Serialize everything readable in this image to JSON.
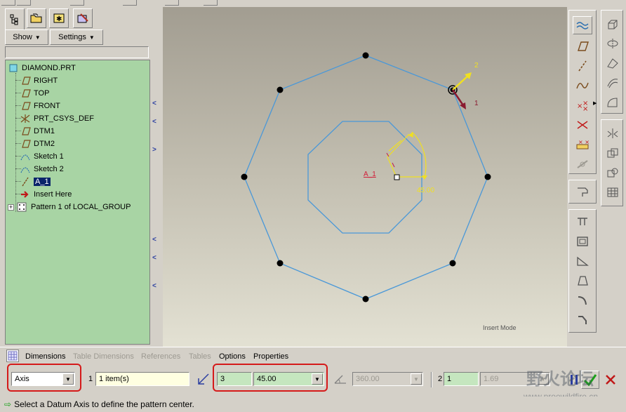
{
  "model_tree": {
    "show_label": "Show",
    "settings_label": "Settings",
    "items": [
      {
        "label": "DIAMOND.PRT",
        "icon": "part-icon"
      },
      {
        "label": "RIGHT",
        "icon": "datum-plane-icon"
      },
      {
        "label": "TOP",
        "icon": "datum-plane-icon"
      },
      {
        "label": "FRONT",
        "icon": "datum-plane-icon"
      },
      {
        "label": "PRT_CSYS_DEF",
        "icon": "csys-icon"
      },
      {
        "label": "DTM1",
        "icon": "datum-plane-icon"
      },
      {
        "label": "DTM2",
        "icon": "datum-plane-icon"
      },
      {
        "label": "Sketch 1",
        "icon": "sketch-icon"
      },
      {
        "label": "Sketch 2",
        "icon": "sketch-icon"
      },
      {
        "label": "A_1",
        "icon": "datum-axis-icon",
        "selected": true
      },
      {
        "label": "Insert Here",
        "icon": "insert-arrow-icon"
      },
      {
        "label": "Pattern 1 of LOCAL_GROUP",
        "icon": "pattern-icon",
        "expand": "+"
      }
    ]
  },
  "canvas": {
    "axis_label": "A_1",
    "angle_label": "45.00",
    "csys_x_label": "1",
    "csys_y_label": "2",
    "mode_label": "Insert Mode"
  },
  "dashboard": {
    "tabs": [
      {
        "label": "Dimensions",
        "enabled": true
      },
      {
        "label": "Table Dimensions",
        "enabled": false
      },
      {
        "label": "References",
        "enabled": false
      },
      {
        "label": "Tables",
        "enabled": false
      },
      {
        "label": "Options",
        "enabled": true
      },
      {
        "label": "Properties",
        "enabled": true
      }
    ],
    "pattern_type": "Axis",
    "first_dir_number": "1",
    "items_value": "1 item(s)",
    "member_count": "3",
    "angle_increment": "45.00",
    "total_angle": "360.00",
    "second_dir_number": "2",
    "second_count": "1",
    "second_value": "1.69"
  },
  "status": {
    "message": "Select a Datum Axis to define the pattern center."
  },
  "watermark": {
    "title": "野火论坛",
    "url": "www.proewildfire.cn"
  }
}
